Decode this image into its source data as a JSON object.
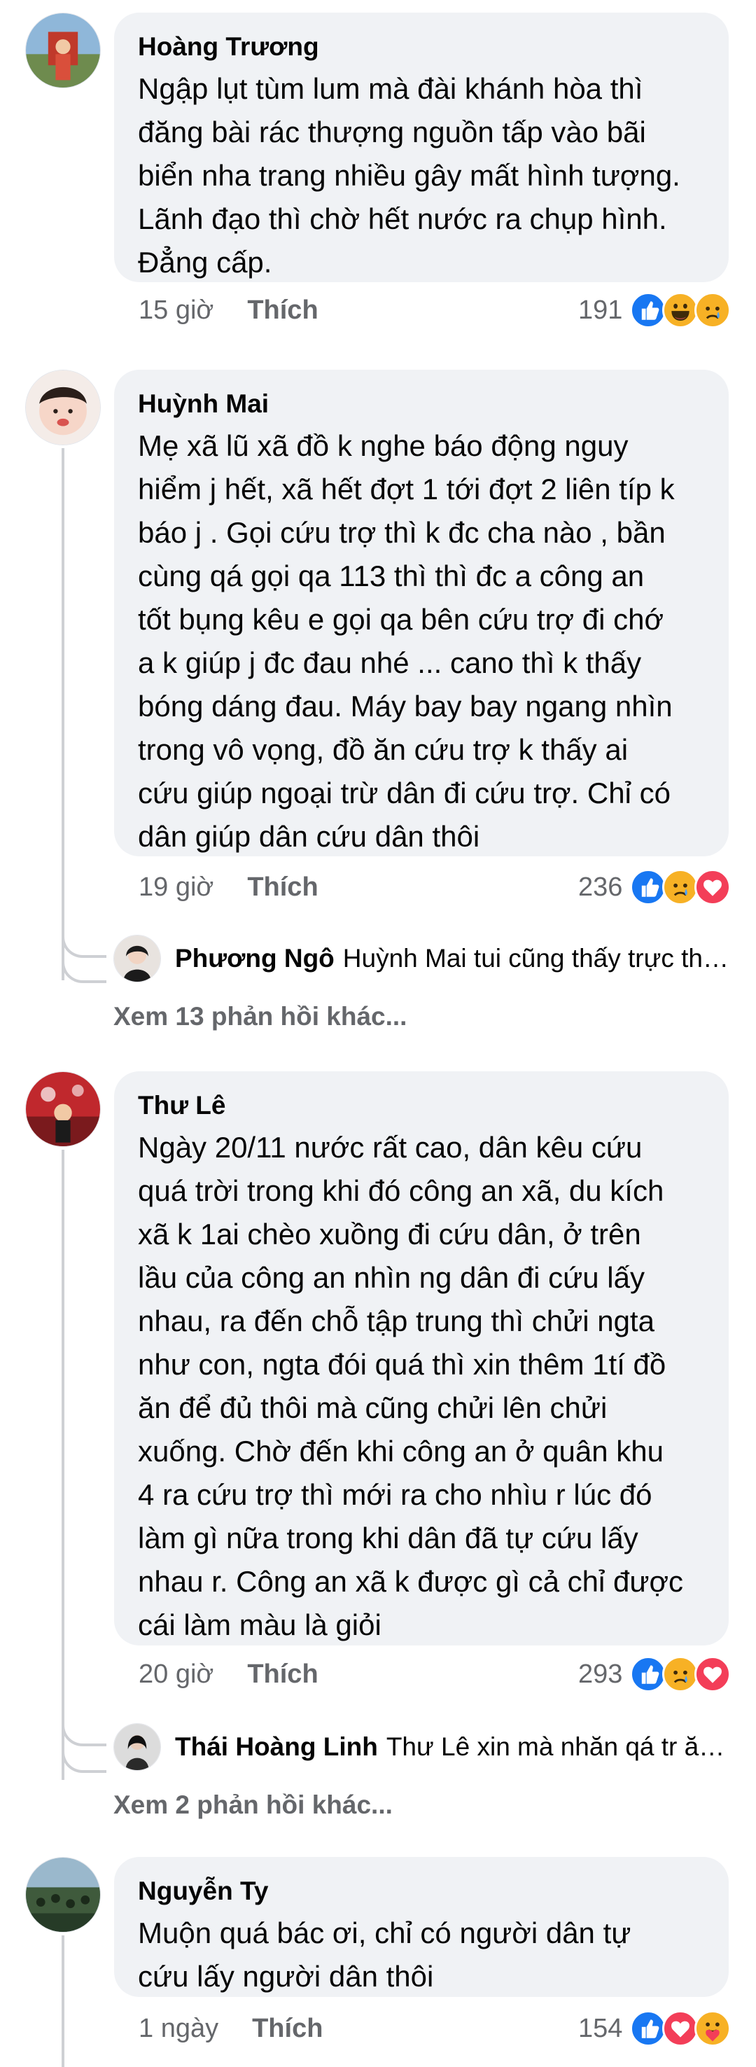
{
  "comments": [
    {
      "author": "Hoàng Trương",
      "text": "Ngập lụt tùm lum mà đài khánh hòa thì\nđăng bài rác thượng nguồn tấp vào bãi\nbiển nha trang nhiều gây mất hình tượng.\nLãnh đạo thì chờ hết nước ra chụp hình.\nĐẳng cấp.",
      "time": "15 giờ",
      "like_label": "Thích",
      "reaction_count": "191",
      "reactions": [
        "like-icon",
        "haha-icon",
        "sad-icon"
      ]
    },
    {
      "author": "Huỳnh Mai",
      "text": "Mẹ xã lũ xã đồ k nghe báo động nguy\nhiểm j hết, xã hết đợt 1 tới đợt 2 liên típ k\nbáo j . Gọi cứu trợ thì k đc cha nào , bần\ncùng qá gọi qa 113 thì thì đc a công an\ntốt bụng kêu e gọi qa bên cứu trợ đi chớ\na k giúp j đc đau nhé ... cano thì k thấy\nbóng dáng đau. Máy bay bay ngang nhìn\ntrong vô vọng, đồ ăn cứu trợ k thấy ai\ncứu giúp ngoại trừ dân đi cứu trợ. Chỉ có\ndân giúp dân cứu dân thôi",
      "time": "19 giờ",
      "like_label": "Thích",
      "reaction_count": "236",
      "reactions": [
        "like-icon",
        "sad-icon",
        "love-icon"
      ],
      "reply": {
        "author": "Phương Ngô",
        "text": "Huỳnh Mai tui cũng thấy trực thă..."
      },
      "more_replies": "Xem 13 phản hồi khác..."
    },
    {
      "author": "Thư Lê",
      "text": "Ngày 20/11 nước rất cao, dân kêu cứu\nquá trời trong khi đó công an xã, du kích\nxã k 1ai chèo xuồng đi cứu dân, ở trên\nlầu của công an nhìn ng dân đi cứu lấy\nnhau, ra đến chỗ tập trung thì chửi ngta\nnhư con, ngta đói quá thì xin thêm 1tí đồ\năn để đủ thôi mà cũng chửi lên chửi\nxuống. Chờ đến khi công an ở quân khu\n4 ra cứu trợ thì mới ra cho nhìu r lúc đó\nlàm gì nữa trong khi dân đã tự cứu lấy\nnhau r. Công an xã k được gì cả chỉ được\ncái làm màu là giỏi",
      "time": "20 giờ",
      "like_label": "Thích",
      "reaction_count": "293",
      "reactions": [
        "like-icon",
        "sad-icon",
        "love-icon"
      ],
      "reply": {
        "author": "Thái Hoàng Linh",
        "text": "Thư Lê xin mà nhăn qá tr ăn,..."
      },
      "more_replies": "Xem 2 phản hồi khác..."
    },
    {
      "author": "Nguyễn Ty",
      "text": "Muộn quá bác ơi, chỉ có người dân tự\ncứu lấy người dân thôi",
      "time": "1 ngày",
      "like_label": "Thích",
      "reaction_count": "154",
      "reactions": [
        "like-icon",
        "love-icon",
        "care-icon"
      ]
    }
  ],
  "colors": {
    "bubble": "#f0f2f5",
    "meta_text": "#65676b",
    "like_blue": "#1877f2",
    "love_red": "#f33e58",
    "haha_yellow": "#f7b125"
  }
}
